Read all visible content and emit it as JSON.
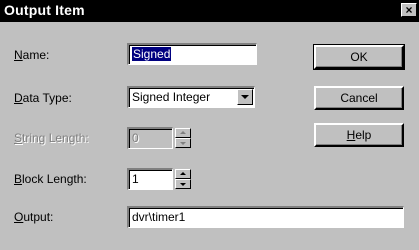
{
  "window": {
    "title": "Output Item",
    "close_label": "×"
  },
  "fields": {
    "name": {
      "label_mn": "N",
      "label_rest": "ame:",
      "value": "Signed"
    },
    "data_type": {
      "label_mn": "D",
      "label_rest": "ata Type:",
      "value": "Signed Integer"
    },
    "string_length": {
      "label_mn": "S",
      "label_rest": "tring Length:",
      "value": "0"
    },
    "block_length": {
      "label_mn": "B",
      "label_rest": "lock Length:",
      "value": "1"
    },
    "output": {
      "label_mn": "O",
      "label_rest": "utput:",
      "value": "dvr\\timer1"
    }
  },
  "buttons": {
    "ok": "OK",
    "cancel": "Cancel",
    "help_mn": "H",
    "help_rest": "elp"
  },
  "icons": {
    "close": "close-icon",
    "combo": "chevron-down-icon",
    "spin_up": "spin-up-icon",
    "spin_down": "spin-down-icon"
  }
}
